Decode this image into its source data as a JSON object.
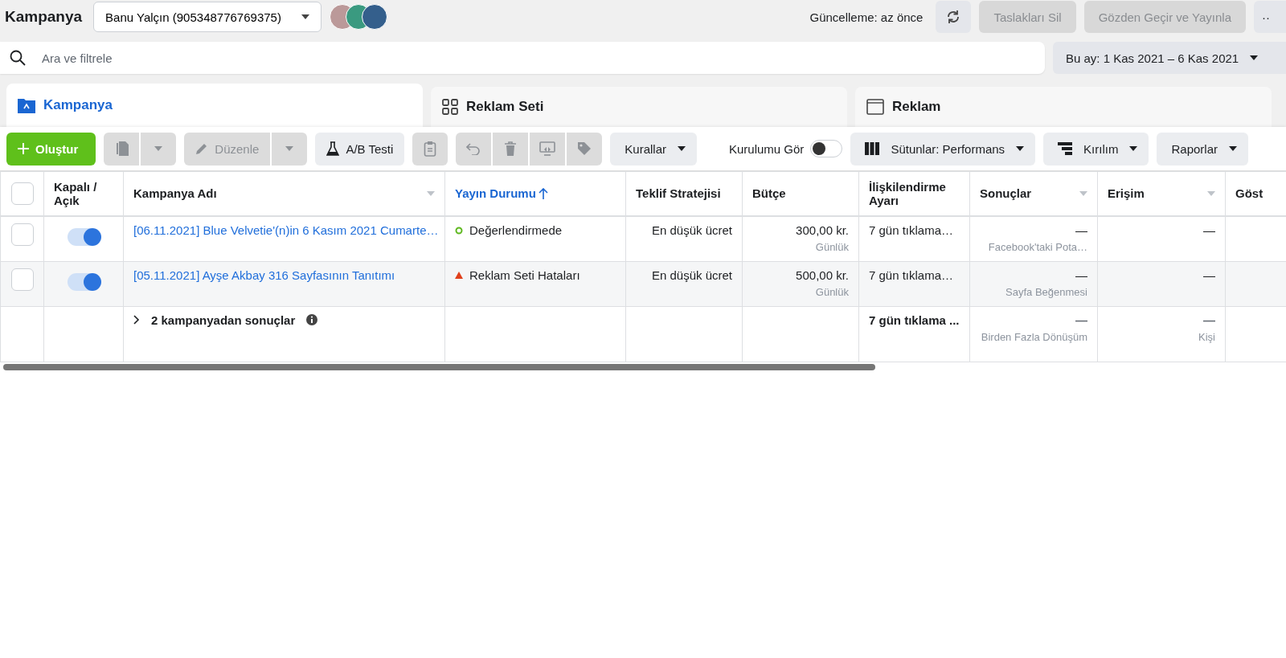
{
  "header": {
    "title": "Kampanya",
    "account": "Banu Yalçın (905348776769375)",
    "update_text": "Güncelleme: az önce",
    "buttons": [
      {
        "kind": "refresh",
        "disabled": false
      },
      {
        "kind": "text",
        "label": "Taslakları Sil",
        "disabled": true
      },
      {
        "kind": "text",
        "label": "Gözden Geçir ve Yayınla",
        "disabled": true
      },
      {
        "kind": "more",
        "label": "··",
        "disabled": false
      }
    ]
  },
  "search": {
    "placeholder": "Ara ve filtrele",
    "date_range": "Bu ay: 1 Kas 2021 – 6 Kas 2021"
  },
  "tabs": [
    {
      "kind": "campaign",
      "label": "Kampanya",
      "selected": true
    },
    {
      "kind": "adset",
      "label": "Reklam Seti",
      "selected": false
    },
    {
      "kind": "ad",
      "label": "Reklam",
      "selected": false
    }
  ],
  "toolbar": [
    {
      "kind": "create",
      "label": "Oluştur"
    },
    {
      "kind": "group",
      "items": [
        {
          "kind": "copy",
          "disabled": true
        },
        {
          "kind": "caret",
          "disabled": true
        }
      ]
    },
    {
      "kind": "group",
      "items": [
        {
          "kind": "edit",
          "label": "Düzenle",
          "disabled": true
        },
        {
          "kind": "caret",
          "disabled": true
        }
      ]
    },
    {
      "kind": "abtest",
      "label": "A/B Testi",
      "disabled": false
    },
    {
      "kind": "clipboard",
      "disabled": true
    },
    {
      "kind": "group",
      "items": [
        {
          "kind": "undo",
          "disabled": true
        },
        {
          "kind": "trash",
          "disabled": true
        },
        {
          "kind": "swap",
          "disabled": true
        },
        {
          "kind": "tag",
          "disabled": true
        }
      ]
    },
    {
      "kind": "dropdown",
      "label": "Kurallar",
      "disabled": false
    },
    {
      "kind": "toggle",
      "label": "Kurulumu Gör",
      "on": false
    },
    {
      "kind": "columns",
      "label": "Sütunlar: Performans",
      "disabled": false
    },
    {
      "kind": "breakdown",
      "label": "Kırılım",
      "disabled": false
    },
    {
      "kind": "dropdown",
      "label": "Raporlar",
      "disabled": false
    }
  ],
  "table": {
    "all_checked": false,
    "columns": [
      {
        "kind": "check"
      },
      {
        "label": "Kapalı / Açık",
        "kind": "toggle"
      },
      {
        "label": "Kampanya Adı",
        "kind": "name",
        "menu": true
      },
      {
        "label": "Yayın Durumu",
        "kind": "status",
        "sorted": true
      },
      {
        "label": "Teklif Stratejisi",
        "kind": "text"
      },
      {
        "label": "Bütçe",
        "kind": "text"
      },
      {
        "label": "İlişkilendirme Ayarı",
        "kind": "text"
      },
      {
        "label": "Sonuçlar",
        "kind": "num",
        "menu": true
      },
      {
        "label": "Erişim",
        "kind": "num",
        "menu": true
      },
      {
        "label": "Göst",
        "kind": "num"
      }
    ],
    "rows": [
      {
        "checked": false,
        "on": true,
        "name": "[06.11.2021] Blue Velvetie'(n)in 6 Kasım 2021 Cumarte…",
        "status": "Değerlendirmede",
        "status_error": false,
        "bid": "En düşük ücret",
        "budget": "300,00 kr.",
        "budget_note": "Günlük",
        "attribution": "7 gün tıklama…",
        "results": "—",
        "results_note": "Facebook'taki Pota…",
        "reach": "—"
      },
      {
        "checked": false,
        "on": true,
        "name": "[05.11.2021] Ayşe Akbay 316 Sayfasının Tanıtımı",
        "status": "Reklam Seti Hataları",
        "status_error": true,
        "bid": "En düşük ücret",
        "budget": "500,00 kr.",
        "budget_note": "Günlük",
        "attribution": "7 gün tıklama…",
        "results": "—",
        "results_note": "Sayfa Beğenmesi",
        "reach": "—"
      }
    ],
    "total": {
      "label": "2 kampanyadan sonuçlar",
      "attribution": "7 gün tıklama ...",
      "results": "—",
      "results_note": "Birden Fazla Dönüşüm",
      "reach": "—",
      "reach_note": "Kişi"
    }
  }
}
